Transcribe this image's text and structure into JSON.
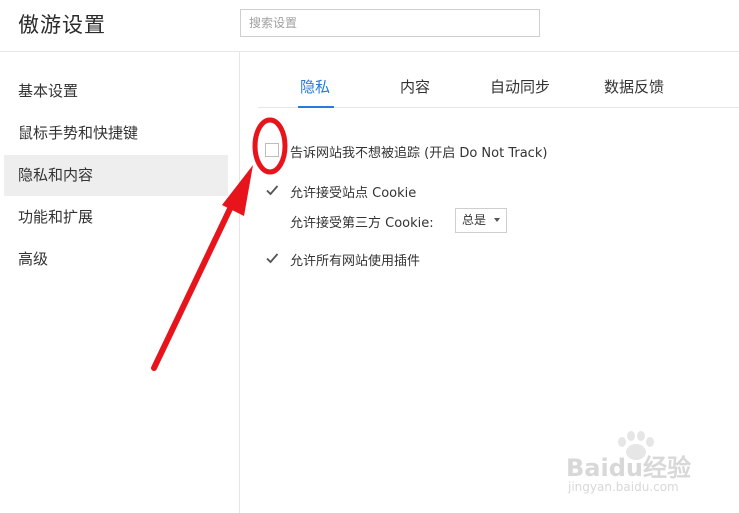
{
  "header": {
    "app_title": "傲游设置",
    "search_placeholder": "搜索设置"
  },
  "sidebar": {
    "items": [
      {
        "label": "基本设置"
      },
      {
        "label": "鼠标手势和快捷键"
      },
      {
        "label": "隐私和内容",
        "active": true
      },
      {
        "label": "功能和扩展"
      },
      {
        "label": "高级"
      }
    ]
  },
  "tabs": [
    {
      "label": "隐私",
      "active": true
    },
    {
      "label": "内容"
    },
    {
      "label": "自动同步"
    },
    {
      "label": "数据反馈"
    }
  ],
  "settings": {
    "dnt_label": "告诉网站我不想被追踪 (开启 Do Not Track)",
    "dnt_checked": false,
    "cookie_label": "允许接受站点 Cookie",
    "cookie_checked": true,
    "third_party_label": "允许接受第三方 Cookie:",
    "third_party_value": "总是",
    "plugins_label": "允许所有网站使用插件",
    "plugins_checked": true
  },
  "annotation": {
    "color": "#e8141c",
    "shape": "circle-with-arrow"
  },
  "watermark": {
    "brand": "Baidu经验",
    "url": "jingyan.baidu.com"
  },
  "colors": {
    "accent": "#2a7ad6",
    "active_bg": "#eeeeee",
    "check": "#555555"
  }
}
